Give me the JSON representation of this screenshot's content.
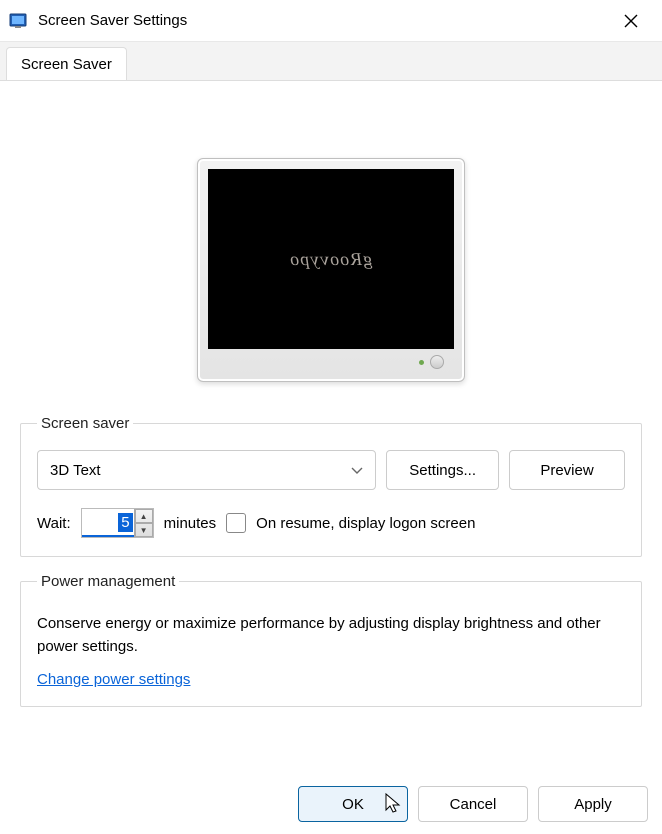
{
  "window": {
    "title": "Screen Saver Settings"
  },
  "tab": {
    "label": "Screen Saver"
  },
  "preview": {
    "text": "gRoovypo"
  },
  "screensaver": {
    "legend": "Screen saver",
    "selected": "3D Text",
    "settings_label": "Settings...",
    "preview_label": "Preview",
    "wait_label": "Wait:",
    "wait_value": "5",
    "minutes_label": "minutes",
    "resume_label": "On resume, display logon screen"
  },
  "power": {
    "legend": "Power management",
    "text": "Conserve energy or maximize performance by adjusting display brightness and other power settings.",
    "link": "Change power settings"
  },
  "buttons": {
    "ok": "OK",
    "cancel": "Cancel",
    "apply": "Apply"
  }
}
